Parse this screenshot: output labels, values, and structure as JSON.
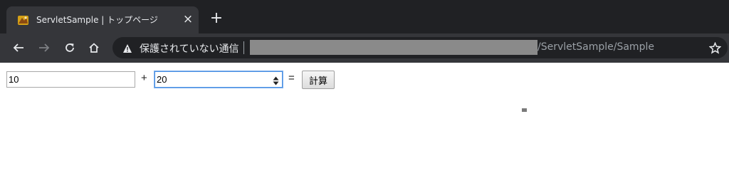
{
  "tab": {
    "title": "ServletSample | トップページ",
    "close_label": "×"
  },
  "new_tab_label": "+",
  "address_bar": {
    "security_text": "保護されていない通信",
    "url_path": "/ServletSample/Sample"
  },
  "calculator": {
    "operand_a": "10",
    "plus_label": "+",
    "operand_b": "20",
    "equals_label": "=",
    "button_label": "計算"
  },
  "colors": {
    "chrome_dark": "#202124",
    "toolbar": "#35363a",
    "focus_border": "#4a90e2"
  },
  "icons": [
    "tomcat-favicon-icon",
    "close-icon",
    "plus-icon",
    "back-arrow-icon",
    "forward-arrow-icon",
    "reload-icon",
    "home-icon",
    "warning-icon",
    "star-icon",
    "spinner-icon"
  ]
}
